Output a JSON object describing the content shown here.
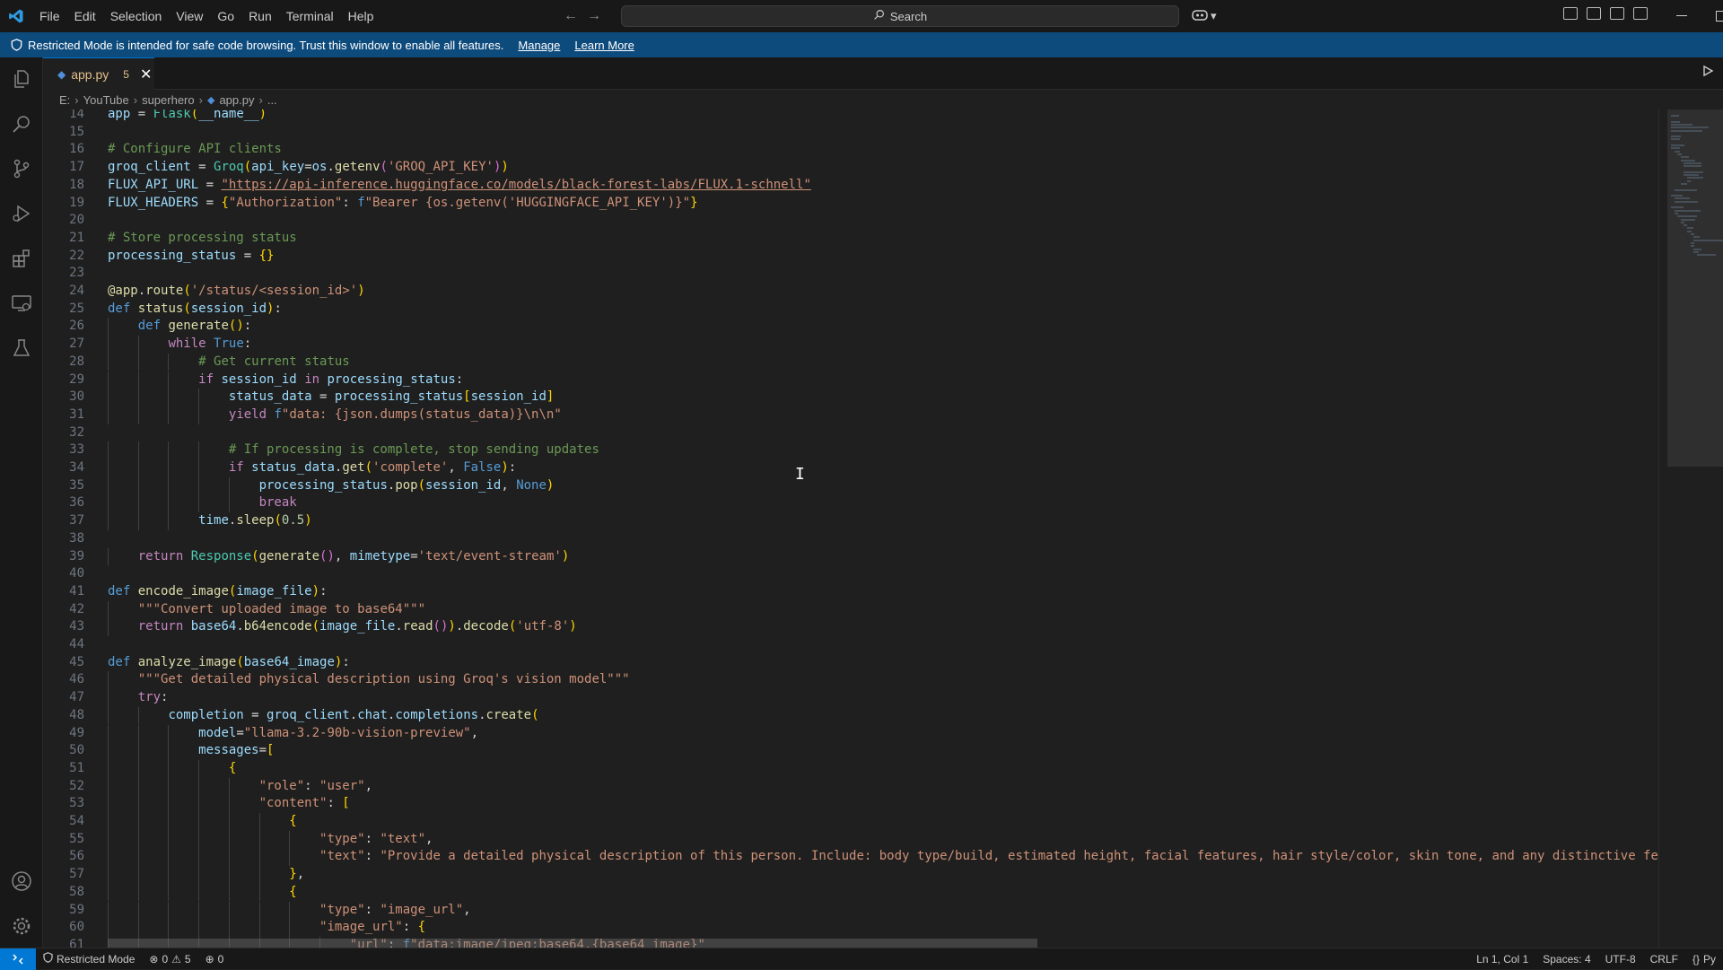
{
  "menu": [
    "File",
    "Edit",
    "Selection",
    "View",
    "Go",
    "Run",
    "Terminal",
    "Help"
  ],
  "search": {
    "label": "Search"
  },
  "banner": {
    "message": "Restricted Mode is intended for safe code browsing. Trust this window to enable all features.",
    "manage": "Manage",
    "learn_more": "Learn More"
  },
  "tab": {
    "name": "app.py",
    "problems": "5"
  },
  "breadcrumb": [
    "E:",
    "YouTube",
    "superhero",
    "app.py",
    "..."
  ],
  "editor": {
    "cursor": "I",
    "lines": [
      {
        "n": "14",
        "t": "app = Flask(__name__)"
      },
      {
        "n": "15",
        "t": ""
      },
      {
        "n": "16",
        "t": "# Configure API clients"
      },
      {
        "n": "17",
        "t": "groq_client = Groq(api_key=os.getenv('GROQ_API_KEY'))"
      },
      {
        "n": "18",
        "t": "FLUX_API_URL = \"https://api-inference.huggingface.co/models/black-forest-labs/FLUX.1-schnell\""
      },
      {
        "n": "19",
        "t": "FLUX_HEADERS = {\"Authorization\": f\"Bearer {os.getenv('HUGGINGFACE_API_KEY')}\"}"
      },
      {
        "n": "20",
        "t": ""
      },
      {
        "n": "21",
        "t": "# Store processing status"
      },
      {
        "n": "22",
        "t": "processing_status = {}"
      },
      {
        "n": "23",
        "t": ""
      },
      {
        "n": "24",
        "t": "@app.route('/status/<session_id>')"
      },
      {
        "n": "25",
        "t": "def status(session_id):"
      },
      {
        "n": "26",
        "t": "    def generate():"
      },
      {
        "n": "27",
        "t": "        while True:"
      },
      {
        "n": "28",
        "t": "            # Get current status"
      },
      {
        "n": "29",
        "t": "            if session_id in processing_status:"
      },
      {
        "n": "30",
        "t": "                status_data = processing_status[session_id]"
      },
      {
        "n": "31",
        "t": "                yield f\"data: {json.dumps(status_data)}\\n\\n\""
      },
      {
        "n": "32",
        "t": ""
      },
      {
        "n": "33",
        "t": "                # If processing is complete, stop sending updates"
      },
      {
        "n": "34",
        "t": "                if status_data.get('complete', False):"
      },
      {
        "n": "35",
        "t": "                    processing_status.pop(session_id, None)"
      },
      {
        "n": "36",
        "t": "                    break"
      },
      {
        "n": "37",
        "t": "            time.sleep(0.5)"
      },
      {
        "n": "38",
        "t": ""
      },
      {
        "n": "39",
        "t": "    return Response(generate(), mimetype='text/event-stream')"
      },
      {
        "n": "40",
        "t": ""
      },
      {
        "n": "41",
        "t": "def encode_image(image_file):"
      },
      {
        "n": "42",
        "t": "    \"\"\"Convert uploaded image to base64\"\"\""
      },
      {
        "n": "43",
        "t": "    return base64.b64encode(image_file.read()).decode('utf-8')"
      },
      {
        "n": "44",
        "t": ""
      },
      {
        "n": "45",
        "t": "def analyze_image(base64_image):"
      },
      {
        "n": "46",
        "t": "    \"\"\"Get detailed physical description using Groq's vision model\"\"\""
      },
      {
        "n": "47",
        "t": "    try:"
      },
      {
        "n": "48",
        "t": "        completion = groq_client.chat.completions.create("
      },
      {
        "n": "49",
        "t": "            model=\"llama-3.2-90b-vision-preview\","
      },
      {
        "n": "50",
        "t": "            messages=["
      },
      {
        "n": "51",
        "t": "                {"
      },
      {
        "n": "52",
        "t": "                    \"role\": \"user\","
      },
      {
        "n": "53",
        "t": "                    \"content\": ["
      },
      {
        "n": "54",
        "t": "                        {"
      },
      {
        "n": "55",
        "t": "                            \"type\": \"text\","
      },
      {
        "n": "56",
        "t": "                            \"text\": \"Provide a detailed physical description of this person. Include: body type/build, estimated height, facial features, hair style/color, skin tone, and any distinctive features. Focu"
      },
      {
        "n": "57",
        "t": "                        },"
      },
      {
        "n": "58",
        "t": "                        {"
      },
      {
        "n": "59",
        "t": "                            \"type\": \"image_url\","
      },
      {
        "n": "60",
        "t": "                            \"image_url\": {"
      },
      {
        "n": "61",
        "t": "                                \"url\": f\"data:image/jpeg;base64,{base64_image}\""
      }
    ]
  },
  "status": {
    "mode": "Restricted Mode",
    "errors": "0",
    "warnings": "5",
    "ports": "0",
    "position": "Ln 1, Col 1",
    "spaces": "Spaces: 4",
    "encoding": "UTF-8",
    "eol": "CRLF",
    "language": "Py"
  },
  "colors": {
    "accent": "#0078d4",
    "banner": "#0e4b7d",
    "tab_modified": "#e2c08d"
  }
}
